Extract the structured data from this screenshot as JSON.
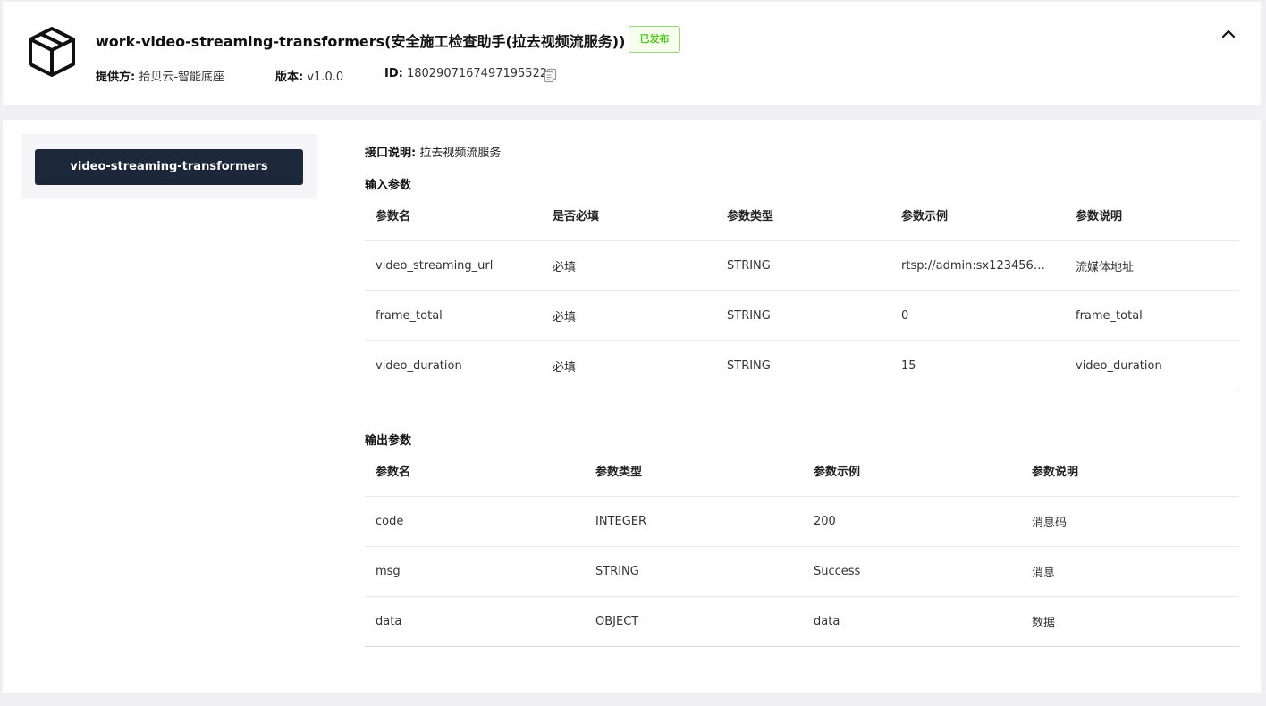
{
  "header": {
    "title": "work-video-streaming-transformers(安全施工检查助手(拉去视频流服务))",
    "status": "已发布",
    "provider_label": "提供方:",
    "provider_value": "拾贝云-智能底座",
    "version_label": "版本:",
    "version_value": "v1.0.0",
    "id_label": "ID:",
    "id_value": "1802907167497195522",
    "icons": {
      "product": "cube-icon",
      "copy": "copy-icon",
      "collapse": "chevron-up-icon"
    }
  },
  "sidebar": {
    "items": [
      {
        "label": "video-streaming-transformers",
        "active": true
      }
    ]
  },
  "interface": {
    "desc_label": "接口说明:",
    "desc_value": "拉去视频流服务"
  },
  "input_params": {
    "title": "输入参数",
    "columns": [
      "参数名",
      "是否必填",
      "参数类型",
      "参数示例",
      "参数说明"
    ],
    "rows": [
      [
        "video_streaming_url",
        "必填",
        "STRING",
        "rtsp://admin:sx123456@...",
        "流媒体地址"
      ],
      [
        "frame_total",
        "必填",
        "STRING",
        "0",
        "frame_total"
      ],
      [
        "video_duration",
        "必填",
        "STRING",
        "15",
        "video_duration"
      ]
    ]
  },
  "output_params": {
    "title": "输出参数",
    "columns": [
      "参数名",
      "参数类型",
      "参数示例",
      "参数说明"
    ],
    "rows": [
      [
        "code",
        "INTEGER",
        "200",
        "消息码"
      ],
      [
        "msg",
        "STRING",
        "Success",
        "消息"
      ],
      [
        "data",
        "OBJECT",
        "data",
        "数据"
      ]
    ]
  },
  "colors": {
    "sidebar_active_bg": "#1c2739",
    "status_green": "#52c41a",
    "page_bg": "#f0f0f2"
  }
}
